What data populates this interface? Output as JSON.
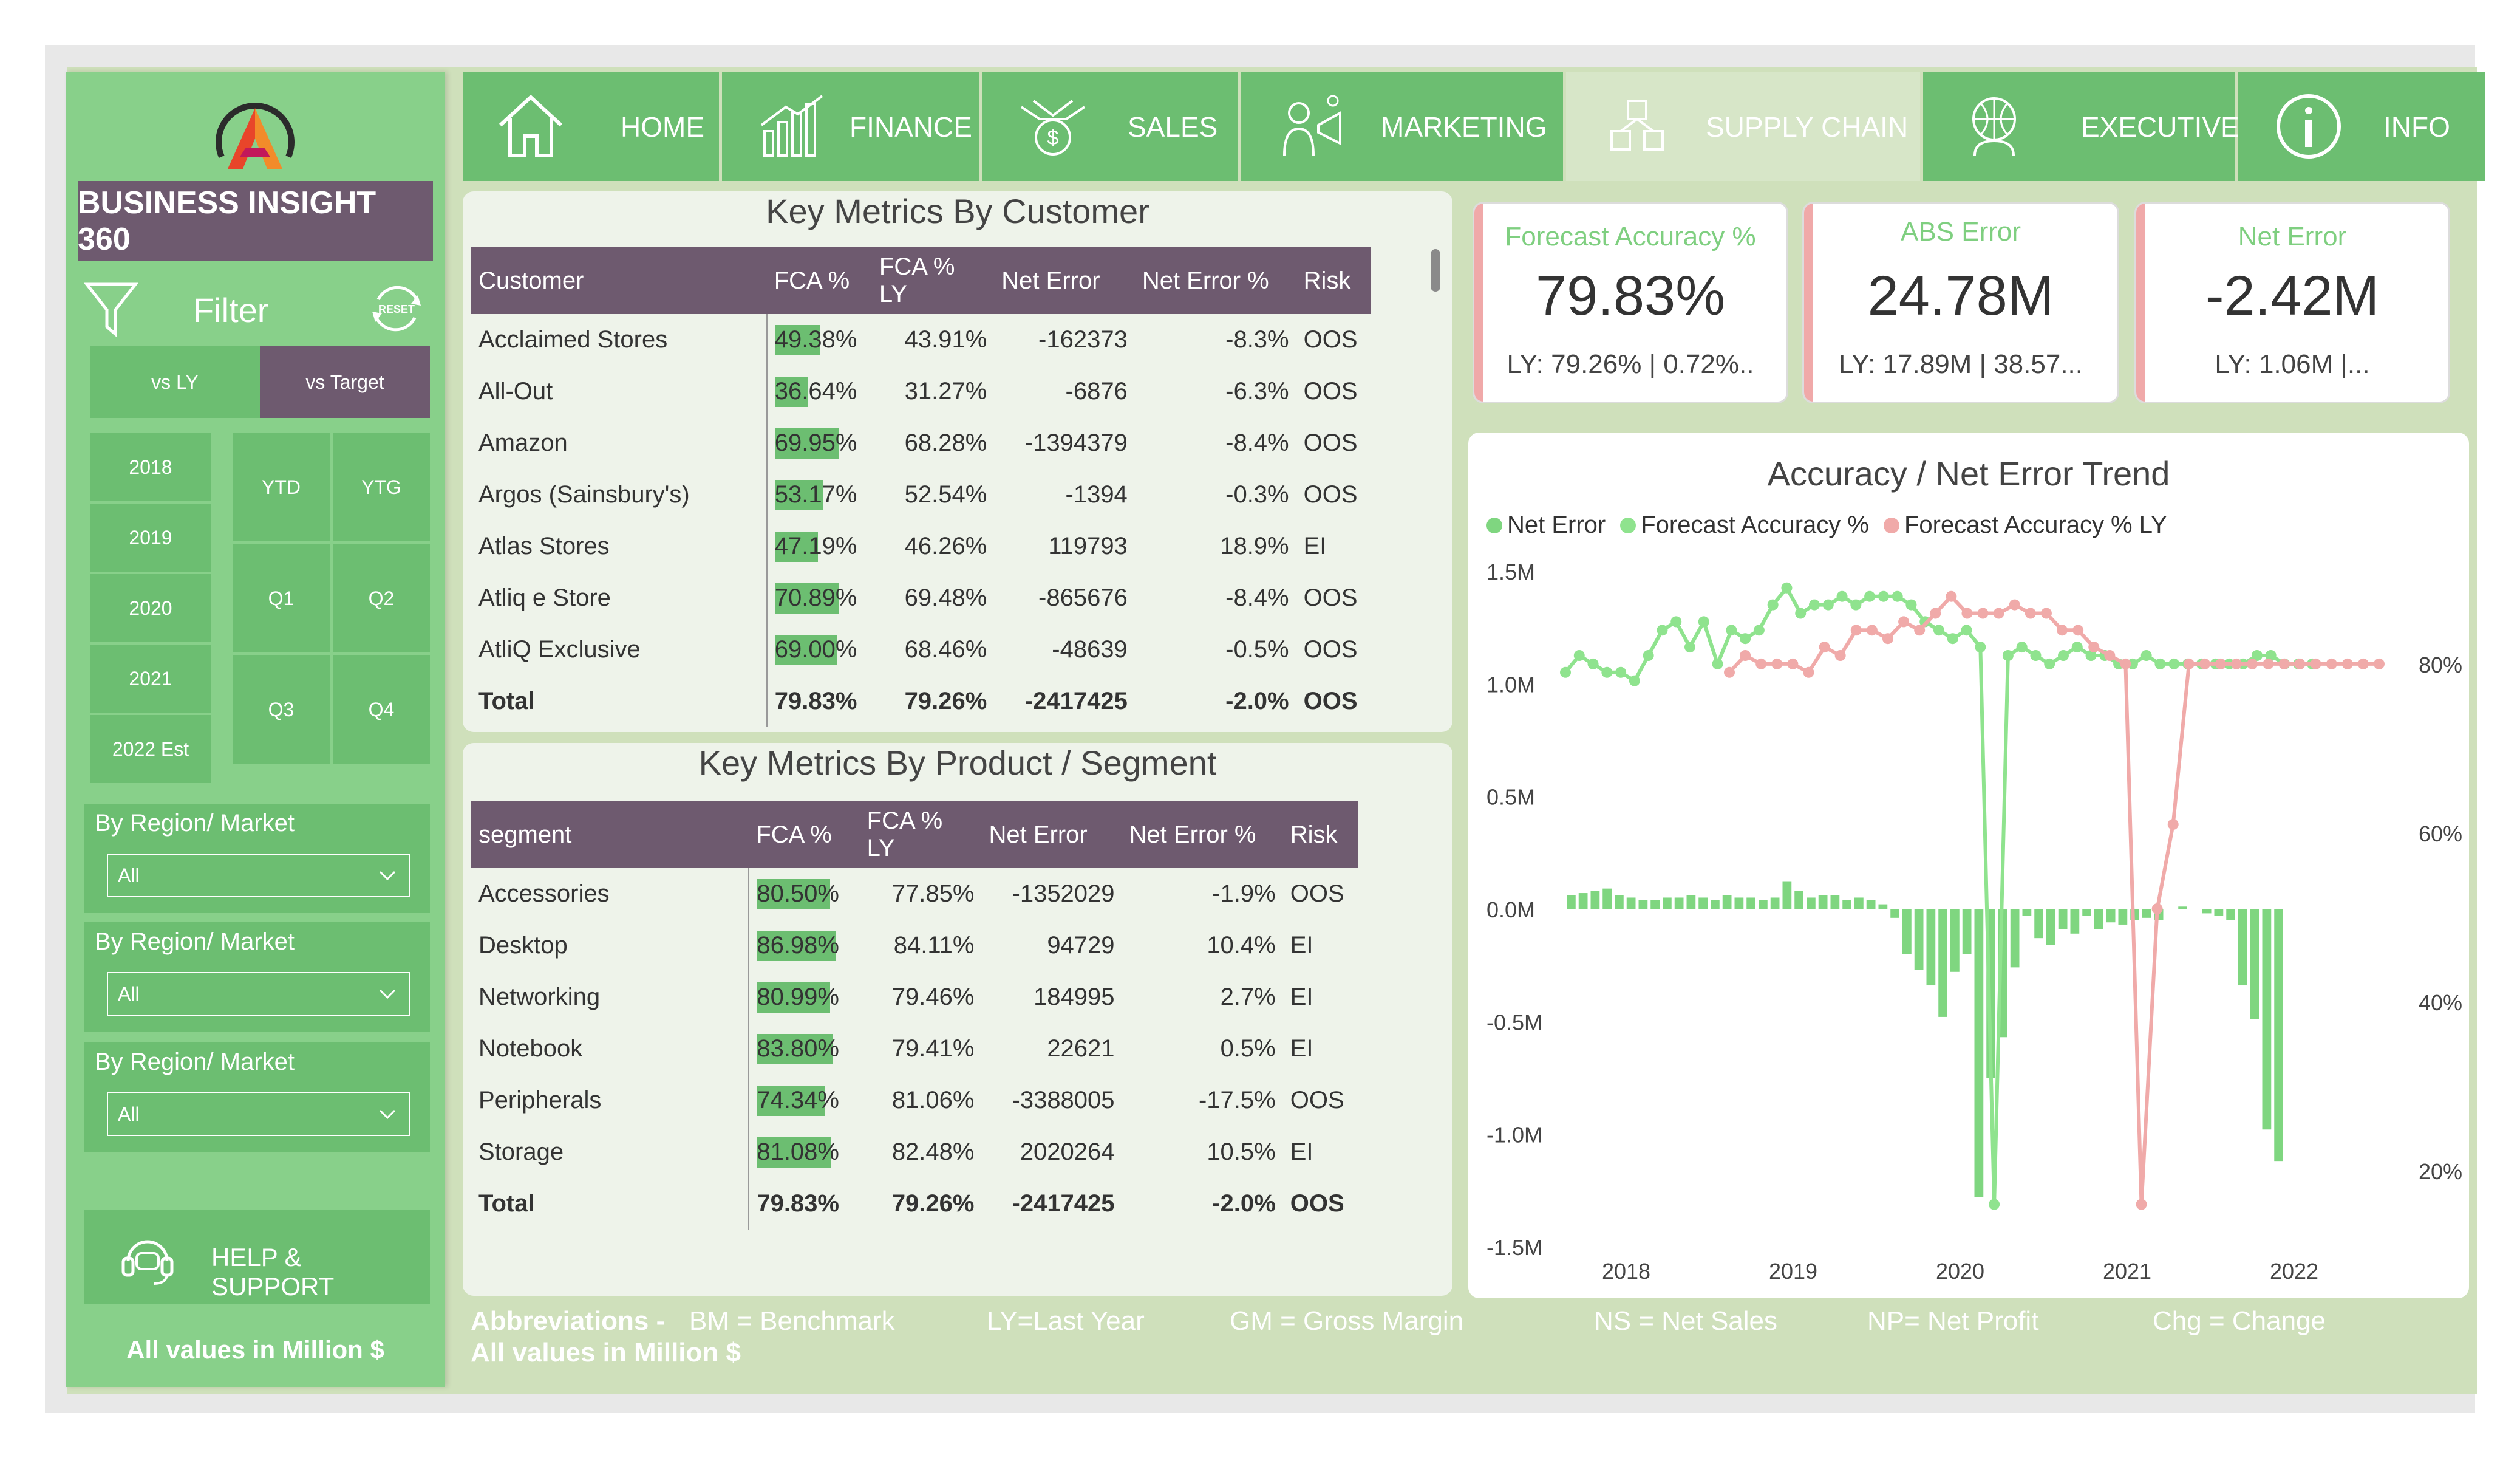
{
  "brand": {
    "title": "BUSINESS INSIGHT 360"
  },
  "sidebar": {
    "filter_label": "Filter",
    "reset_label": "RESET",
    "toggle": [
      "vs LY",
      "vs Target"
    ],
    "years": [
      "2018",
      "2019",
      "2020",
      "2021",
      "2022 Est"
    ],
    "periods": [
      "YTD",
      "YTG",
      "Q1",
      "Q2",
      "Q3",
      "Q4"
    ],
    "slicers": [
      {
        "title": "By Region/ Market",
        "value": "All"
      },
      {
        "title": "By Region/ Market",
        "value": "All"
      },
      {
        "title": "By Region/ Market",
        "value": "All"
      }
    ],
    "help_label": "HELP & SUPPORT",
    "all_values": "All values in Million $"
  },
  "nav": [
    {
      "label": "HOME",
      "icon": "home-icon"
    },
    {
      "label": "FINANCE",
      "icon": "finance-icon"
    },
    {
      "label": "SALES",
      "icon": "sales-icon"
    },
    {
      "label": "MARKETING",
      "icon": "marketing-icon"
    },
    {
      "label": "SUPPLY CHAIN",
      "icon": "supply-chain-icon",
      "active": true
    },
    {
      "label": "EXECUTIVE",
      "icon": "executive-icon"
    },
    {
      "label": "INFO",
      "icon": "info-icon"
    }
  ],
  "customer_table": {
    "title": "Key Metrics By Customer",
    "headers": [
      "Customer",
      "FCA %",
      "FCA % LY",
      "Net Error",
      "Net Error %",
      "Risk"
    ],
    "rows": [
      {
        "name": "Acclaimed Stores",
        "fca": "49.38%",
        "fca_value": 49.38,
        "fca_ly": "43.91%",
        "net_error": "-162373",
        "net_error_pct": "-8.3%",
        "risk": "OOS"
      },
      {
        "name": "All-Out",
        "fca": "36.64%",
        "fca_value": 36.64,
        "fca_ly": "31.27%",
        "net_error": "-6876",
        "net_error_pct": "-6.3%",
        "risk": "OOS"
      },
      {
        "name": "Amazon",
        "fca": "69.95%",
        "fca_value": 69.95,
        "fca_ly": "68.28%",
        "net_error": "-1394379",
        "net_error_pct": "-8.4%",
        "risk": "OOS"
      },
      {
        "name": "Argos (Sainsbury's)",
        "fca": "53.17%",
        "fca_value": 53.17,
        "fca_ly": "52.54%",
        "net_error": "-1394",
        "net_error_pct": "-0.3%",
        "risk": "OOS"
      },
      {
        "name": "Atlas Stores",
        "fca": "47.19%",
        "fca_value": 47.19,
        "fca_ly": "46.26%",
        "net_error": "119793",
        "net_error_pct": "18.9%",
        "risk": "EI"
      },
      {
        "name": "Atliq e Store",
        "fca": "70.89%",
        "fca_value": 70.89,
        "fca_ly": "69.48%",
        "net_error": "-865676",
        "net_error_pct": "-8.4%",
        "risk": "OOS"
      },
      {
        "name": "AtliQ Exclusive",
        "fca": "69.00%",
        "fca_value": 69.0,
        "fca_ly": "68.46%",
        "net_error": "-48639",
        "net_error_pct": "-0.5%",
        "risk": "OOS"
      }
    ],
    "total": {
      "name": "Total",
      "fca": "79.83%",
      "fca_ly": "79.26%",
      "net_error": "-2417425",
      "net_error_pct": "-2.0%",
      "risk": "OOS"
    }
  },
  "segment_table": {
    "title": "Key Metrics By Product / Segment",
    "headers": [
      "segment",
      "FCA %",
      "FCA % LY",
      "Net Error",
      "Net Error %",
      "Risk"
    ],
    "rows": [
      {
        "name": "Accessories",
        "fca": "80.50%",
        "fca_value": 80.5,
        "fca_ly": "77.85%",
        "net_error": "-1352029",
        "net_error_pct": "-1.9%",
        "risk": "OOS"
      },
      {
        "name": "Desktop",
        "fca": "86.98%",
        "fca_value": 86.98,
        "fca_ly": "84.11%",
        "net_error": "94729",
        "net_error_pct": "10.4%",
        "risk": "EI"
      },
      {
        "name": "Networking",
        "fca": "80.99%",
        "fca_value": 80.99,
        "fca_ly": "79.46%",
        "net_error": "184995",
        "net_error_pct": "2.7%",
        "risk": "EI"
      },
      {
        "name": "Notebook",
        "fca": "83.80%",
        "fca_value": 83.8,
        "fca_ly": "79.41%",
        "net_error": "22621",
        "net_error_pct": "0.5%",
        "risk": "EI"
      },
      {
        "name": "Peripherals",
        "fca": "74.34%",
        "fca_value": 74.34,
        "fca_ly": "81.06%",
        "net_error": "-3388005",
        "net_error_pct": "-17.5%",
        "risk": "OOS"
      },
      {
        "name": "Storage",
        "fca": "81.08%",
        "fca_value": 81.08,
        "fca_ly": "82.48%",
        "net_error": "2020264",
        "net_error_pct": "10.5%",
        "risk": "EI"
      }
    ],
    "total": {
      "name": "Total",
      "fca": "79.83%",
      "fca_ly": "79.26%",
      "net_error": "-2417425",
      "net_error_pct": "-2.0%",
      "risk": "OOS"
    }
  },
  "kpis": [
    {
      "title": "Forecast Accuracy %",
      "value": "79.83%",
      "sub": "LY: 79.26% | 0.72%.."
    },
    {
      "title": "ABS Error",
      "value": "24.78M",
      "sub": "LY: 17.89M | 38.57..."
    },
    {
      "title": "Net Error",
      "value": "-2.42M",
      "sub": "LY: 1.06M |..."
    }
  ],
  "colors": {
    "net_error": "#7fd680",
    "forecast_accuracy": "#8fe38e",
    "forecast_accuracy_ly": "#f0aaa9",
    "header": "#6e5a6f",
    "accent_green": "#6cbe71"
  },
  "chart_data": {
    "type": "line",
    "title": "Accuracy / Net Error Trend",
    "legend": [
      "Net Error",
      "Forecast Accuracy %",
      "Forecast Accuracy % LY"
    ],
    "x_tick_labels": [
      "2018",
      "2019",
      "2020",
      "2021",
      "2022"
    ],
    "y_left_ticks": [
      "1.5M",
      "1.0M",
      "0.5M",
      "0.0M",
      "-0.5M",
      "-1.0M",
      "-1.5M"
    ],
    "y_left_range": [
      -1.5,
      1.5
    ],
    "y_right_ticks": [
      "80%",
      "60%",
      "40%",
      "20%"
    ],
    "y_right_range": [
      11,
      91
    ],
    "series": [
      {
        "name": "Net Error",
        "type": "bar",
        "axis": "left",
        "values": [
          0.06,
          0.07,
          0.08,
          0.09,
          0.06,
          0.05,
          0.04,
          0.04,
          0.05,
          0.05,
          0.06,
          0.05,
          0.04,
          0.06,
          0.05,
          0.05,
          0.04,
          0.05,
          0.12,
          0.08,
          0.05,
          0.06,
          0.06,
          0.04,
          0.05,
          0.04,
          0.02,
          -0.04,
          -0.2,
          -0.27,
          -0.34,
          -0.48,
          -0.28,
          -0.2,
          -1.28,
          -0.75,
          -0.57,
          -0.26,
          -0.03,
          -0.13,
          -0.16,
          -0.09,
          -0.11,
          -0.03,
          -0.09,
          -0.06,
          -0.07,
          -0.05,
          -0.04,
          -0.05,
          0.0,
          0.01,
          0.0,
          -0.02,
          -0.03,
          -0.05,
          -0.34,
          -0.49,
          -0.98,
          -1.12
        ]
      },
      {
        "name": "Forecast Accuracy %",
        "type": "line",
        "axis": "right",
        "values": [
          79,
          81,
          80,
          79,
          79,
          78,
          81,
          84,
          85,
          82,
          85,
          80,
          84,
          83,
          84,
          87,
          89,
          86,
          87,
          87,
          88,
          87,
          88,
          88,
          88,
          87,
          85,
          84,
          83,
          84,
          82,
          16,
          81,
          82,
          81,
          80,
          81,
          82,
          81,
          81,
          80,
          80,
          81,
          80,
          80,
          80,
          80,
          80,
          80,
          80,
          81,
          81,
          80,
          80,
          80
        ]
      },
      {
        "name": "Forecast Accuracy % LY",
        "type": "line",
        "axis": "right",
        "values": [
          79,
          81,
          80,
          80,
          80,
          79,
          82,
          81,
          84,
          84,
          83,
          85,
          84,
          86,
          88,
          86,
          86,
          86,
          87,
          86,
          86,
          84,
          84,
          82,
          81,
          80,
          16,
          51,
          61,
          80,
          80,
          80,
          80,
          80,
          80,
          80,
          80,
          80,
          80,
          80,
          80,
          80
        ]
      }
    ]
  },
  "footer": {
    "abbr_label": "Abbreviations -",
    "items": [
      "BM = Benchmark",
      "LY=Last Year",
      "GM = Gross Margin",
      "NS = Net Sales",
      "NP= Net Profit",
      "Chg = Change"
    ],
    "all_values": "All values in Million $"
  }
}
